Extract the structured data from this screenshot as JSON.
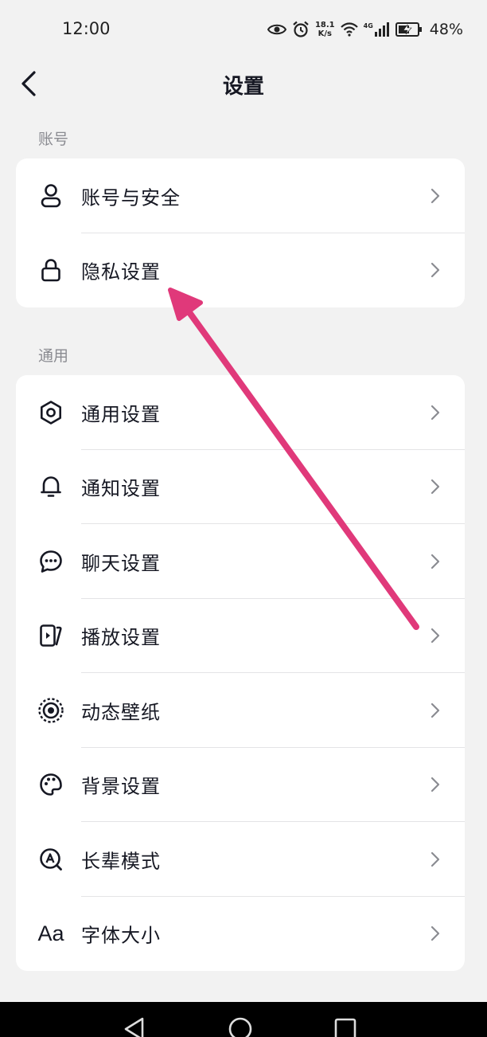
{
  "status_bar": {
    "time": "12:00",
    "net_speed_value": "18.1",
    "net_speed_unit": "K/s",
    "network_type": "4G",
    "battery_percent": "48%",
    "icons": [
      "eye-icon",
      "alarm-icon",
      "wifi-icon",
      "signal-icon",
      "battery-icon"
    ]
  },
  "header": {
    "title": "设置",
    "back_icon": "chevron-left-icon"
  },
  "sections": [
    {
      "label": "账号",
      "items": [
        {
          "label": "账号与安全",
          "icon": "user-icon"
        },
        {
          "label": "隐私设置",
          "icon": "lock-icon"
        }
      ]
    },
    {
      "label": "通用",
      "items": [
        {
          "label": "通用设置",
          "icon": "gear-icon"
        },
        {
          "label": "通知设置",
          "icon": "bell-icon"
        },
        {
          "label": "聊天设置",
          "icon": "chat-bubble-icon"
        },
        {
          "label": "播放设置",
          "icon": "play-icon"
        },
        {
          "label": "动态壁纸",
          "icon": "live-wallpaper-icon"
        },
        {
          "label": "背景设置",
          "icon": "palette-icon"
        },
        {
          "label": "长辈模式",
          "icon": "elder-mode-icon"
        },
        {
          "label": "字体大小",
          "icon": "font-size-icon",
          "icon_text": "Aa"
        }
      ]
    }
  ],
  "nav_bar": {
    "icons": [
      "back-triangle-icon",
      "home-circle-icon",
      "recents-square-icon"
    ]
  },
  "colors": {
    "background": "#f2f2f2",
    "card": "#ffffff",
    "text": "#161823",
    "muted": "#8a8b91",
    "annotation_arrow": "#e0397a"
  }
}
